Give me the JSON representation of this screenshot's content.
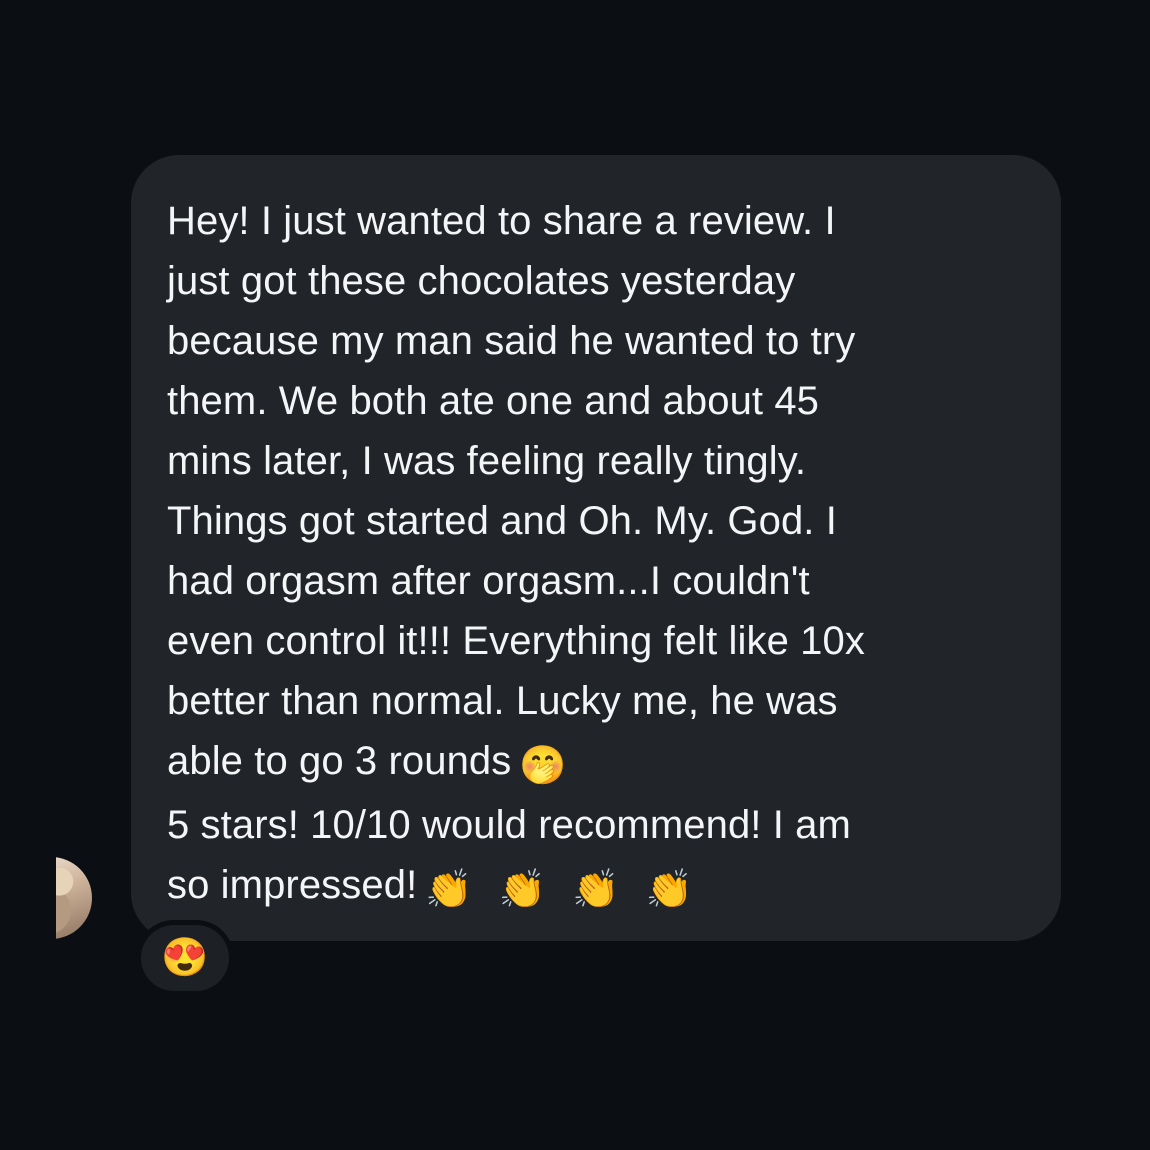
{
  "message": {
    "lines": [
      "Hey!  I just wanted to share a review.  I",
      "just got these chocolates yesterday",
      "because my man said he wanted to try",
      "them.  We both ate one and about 45",
      "mins later,  I was feeling really tingly.",
      "Things got started and Oh. My. God. I",
      "had orgasm after orgasm...I couldn't",
      "even control it!!! Everything felt like 10x",
      "better than normal.  Lucky me,  he was",
      "able to go 3 rounds",
      "5 stars!  10/10 would recommend! I am",
      "so impressed!"
    ],
    "inline_emojis": {
      "line_10": "🤭",
      "line_12": [
        "👏",
        "👏",
        "👏",
        "👏"
      ]
    }
  },
  "reaction": {
    "emoji": "😍"
  },
  "icons": {
    "sender_avatar": "avatar-image",
    "reaction_icon": "heart-eyes-emoji-icon",
    "hand_over_mouth_icon": "hand-over-mouth-emoji-icon",
    "clapping_icon": "clapping-hands-emoji-icon"
  },
  "colors": {
    "background": "#0b0e13",
    "bubble": "#212429",
    "text": "#f4f5f7"
  }
}
